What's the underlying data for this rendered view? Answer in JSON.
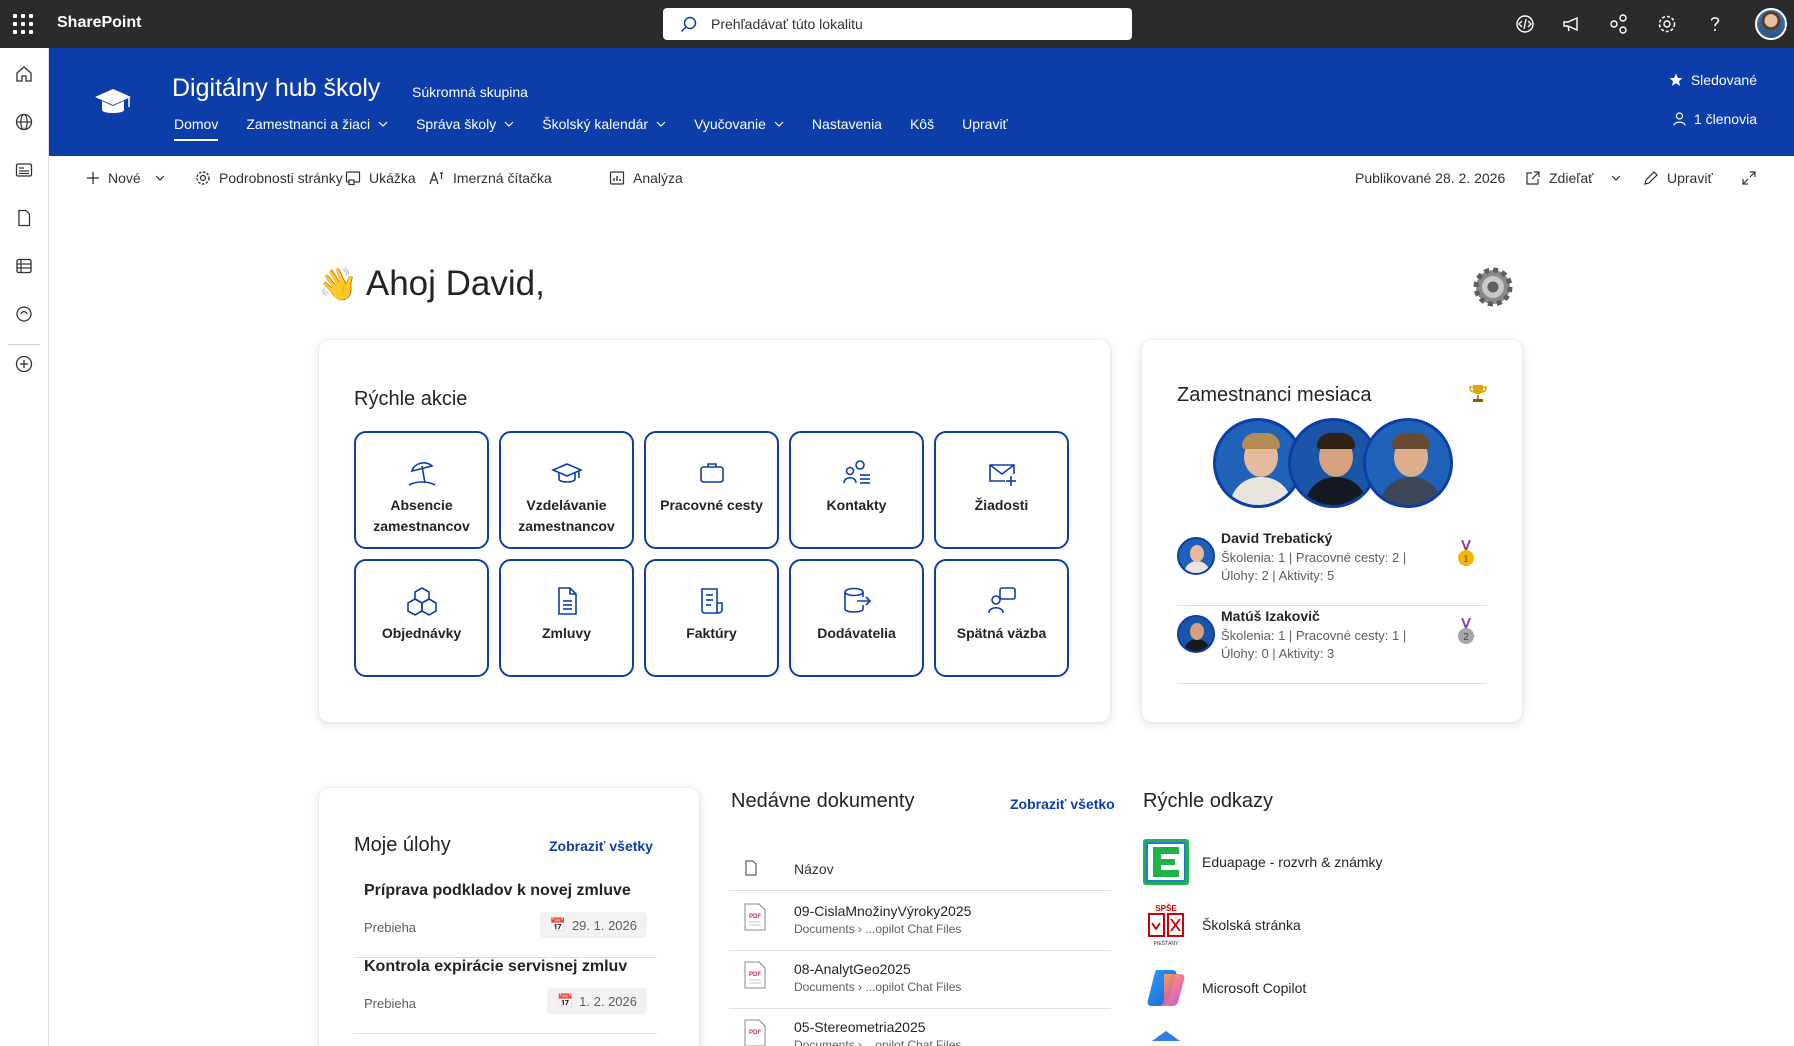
{
  "suite": {
    "app_name": "SharePoint",
    "search_placeholder": "Prehľadávať túto lokalitu"
  },
  "site": {
    "title": "Digitálny hub školy",
    "privacy": "Súkromná skupina",
    "nav": [
      {
        "label": "Domov"
      },
      {
        "label": "Zamestnanci a žiaci"
      },
      {
        "label": "Správa školy"
      },
      {
        "label": "Školský kalendár"
      },
      {
        "label": "Vyučovanie"
      },
      {
        "label": "Nastavenia"
      },
      {
        "label": "Kôš"
      },
      {
        "label": "Upraviť"
      }
    ],
    "follow_label": "Sledované",
    "members_label": "1 členovia"
  },
  "command_bar": {
    "new": "Nové",
    "page_details": "Podrobnosti stránky",
    "preview": "Ukážka",
    "immersive_reader": "Imerzná čítačka",
    "analytics": "Analýza",
    "published": "Publikované 28. 2. 2026",
    "share": "Zdieľať",
    "edit": "Upraviť"
  },
  "greeting": {
    "emoji": "👋",
    "text": "Ahoj David,"
  },
  "quick_actions": {
    "title": "Rýchle akcie",
    "items": [
      {
        "label": "Absencie zamestnancov",
        "icon": "beach-umbrella-icon"
      },
      {
        "label": "Vzdelávanie zamestnancov",
        "icon": "graduation-cap-icon"
      },
      {
        "label": "Pracovné cesty",
        "icon": "briefcase-icon"
      },
      {
        "label": "Kontakty",
        "icon": "people-list-icon"
      },
      {
        "label": "Žiadosti",
        "icon": "mail-add-icon"
      },
      {
        "label": "Objednávky",
        "icon": "boxes-icon"
      },
      {
        "label": "Zmluvy",
        "icon": "document-icon"
      },
      {
        "label": "Faktúry",
        "icon": "receipt-icon"
      },
      {
        "label": "Dodávatelia",
        "icon": "database-arrow-icon"
      },
      {
        "label": "Spätná väzba",
        "icon": "feedback-icon"
      }
    ]
  },
  "employees_of_month": {
    "title": "Zamestnanci mesiaca",
    "people": [
      {
        "name": "David Trebatický",
        "stats_line1": "Školenia: 1 | Pracovné cesty: 2 |",
        "stats_line2": "Úlohy: 2 | Aktivity: 5",
        "medal": "1",
        "medal_color": "#f2b600"
      },
      {
        "name": "Matúš Izakovič",
        "stats_line1": "Školenia: 1 | Pracovné cesty: 1 |",
        "stats_line2": "Úlohy: 0 | Aktivity: 3",
        "medal": "2",
        "medal_color": "#a6a6a6"
      }
    ]
  },
  "tasks": {
    "title": "Moje úlohy",
    "show_all": "Zobraziť všetky",
    "items": [
      {
        "title": "Príprava podkladov k novej zmluve",
        "status": "Prebieha",
        "date": "29. 1. 2026"
      },
      {
        "title": "Kontrola expirácie servisnej zmluv",
        "status": "Prebieha",
        "date": "1. 2. 2026"
      }
    ]
  },
  "recent_docs": {
    "title": "Nedávne dokumenty",
    "show_all": "Zobraziť všetko",
    "column_name": "Názov",
    "items": [
      {
        "name": "09-CislaMnožinyVýroky2025",
        "path": "Documents › ...opilot Chat Files"
      },
      {
        "name": "08-AnalytGeo2025",
        "path": "Documents › ...opilot Chat Files"
      },
      {
        "name": "05-Stereometria2025",
        "path": "Documents › ...opilot Chat Files"
      }
    ]
  },
  "quick_links": {
    "title": "Rýchle odkazy",
    "items": [
      {
        "label": "Eduapage - rozvrh & známky",
        "icon": "edupage-logo"
      },
      {
        "label": "Školská stránka",
        "icon": "school-crest-logo",
        "logo_text_top": "SPŠE",
        "logo_text_bottom": "PIEŠŤANY"
      },
      {
        "label": "Microsoft Copilot",
        "icon": "copilot-logo"
      },
      {
        "label": "",
        "icon": "partial-logo"
      }
    ]
  },
  "colors": {
    "brand": "#0b3ea8",
    "suite_bar": "#2b2b2b"
  }
}
